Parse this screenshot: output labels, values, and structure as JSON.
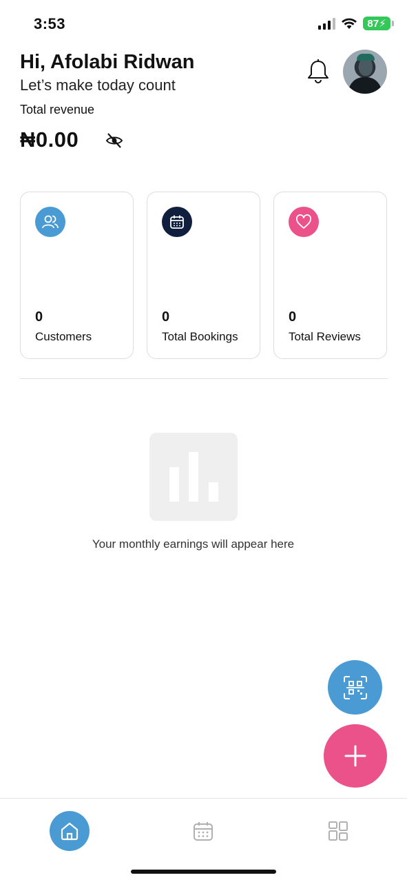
{
  "status_bar": {
    "time": "3:53",
    "battery": "87"
  },
  "header": {
    "greeting": "Hi, Afolabi Ridwan",
    "subtitle": "Let’s make today count",
    "bell_icon": "bell-icon",
    "avatar_icon": "user-avatar"
  },
  "revenue": {
    "label": "Total revenue",
    "amount": "₦0.00",
    "visibility_icon": "eye-off-icon"
  },
  "stats": [
    {
      "value": "0",
      "label": "Customers",
      "icon": "users-icon",
      "color": "#4a9bd4"
    },
    {
      "value": "0",
      "label": "Total Bookings",
      "icon": "calendar-icon",
      "color": "#0f1f3d"
    },
    {
      "value": "0",
      "label": "Total Reviews",
      "icon": "heart-icon",
      "color": "#ea5289"
    }
  ],
  "earnings": {
    "empty_message": "Your monthly earnings will appear here",
    "placeholder_icon": "bar-chart-icon"
  },
  "fab": {
    "scan_icon": "qr-scan-icon",
    "scan_color": "#4a9bd4",
    "add_icon": "plus-icon",
    "add_color": "#ea5289"
  },
  "bottom_nav": {
    "items": [
      {
        "icon": "home-icon",
        "active": true
      },
      {
        "icon": "calendar-icon",
        "active": false
      },
      {
        "icon": "grid-icon",
        "active": false
      }
    ],
    "active_color": "#4a9bd4"
  }
}
